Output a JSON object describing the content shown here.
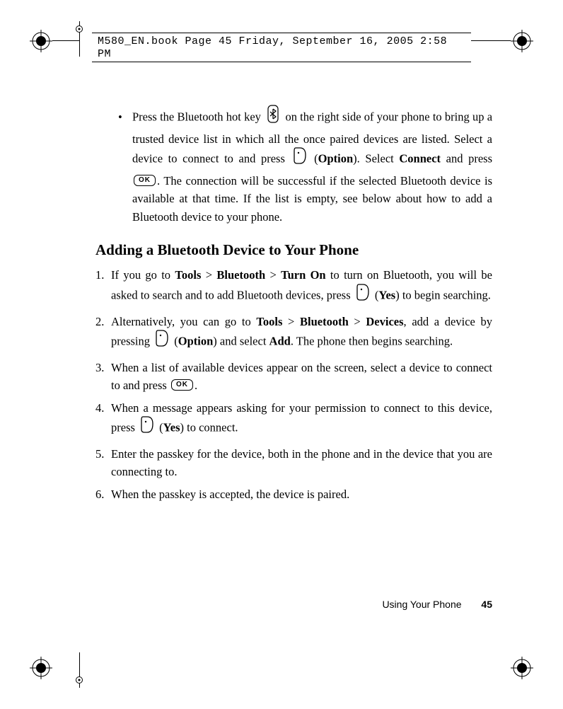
{
  "header": {
    "crop_text": "M580_EN.book  Page 45  Friday, September 16, 2005  2:58 PM"
  },
  "bullet": {
    "pre": "Press the Bluetooth hot key ",
    "mid1": " on the right side of your phone to bring up a trusted device list in which all the once paired devices are listed. Select a device to connect to and press ",
    "option": "Option",
    "mid2": "). Select ",
    "connect": "Connect",
    "mid3": " and press ",
    "mid4": ". The connection will be successful if the selected Bluetooth device is available at that time. If the list is empty, see below about how to add a Bluetooth device to your phone."
  },
  "section_title": "Adding a Bluetooth Device to Your Phone",
  "steps": {
    "s1": {
      "a": "If you go to ",
      "tools": "Tools",
      "gt1": " > ",
      "bluetooth": "Bluetooth",
      "gt2": " > ",
      "turnon": "Turn On",
      "b": " to turn on Bluetooth, you will be asked to search and to add Bluetooth devices, press ",
      "yes": "Yes",
      "c": ") to begin searching."
    },
    "s2": {
      "a": "Alternatively, you can go to ",
      "tools": "Tools",
      "gt1": " > ",
      "bluetooth": "Bluetooth",
      "gt2": " > ",
      "devices": "Devices",
      "b": ", add a device by pressing ",
      "option": "Option",
      "c": ") and select ",
      "add": "Add",
      "d": ". The phone then begins searching."
    },
    "s3": {
      "a": "When a list of available devices appear on the screen, select a device to connect to and press ",
      "b": "."
    },
    "s4": {
      "a": "When a message appears asking for your permission to connect to this device, press ",
      "yes": "Yes",
      "b": ") to connect."
    },
    "s5": "Enter the passkey for the device, both in the phone and in the device that you are connecting to.",
    "s6": "When the passkey is accepted, the device is paired."
  },
  "footer": {
    "label": "Using Your Phone",
    "page": "45"
  },
  "ok_label": "OK"
}
